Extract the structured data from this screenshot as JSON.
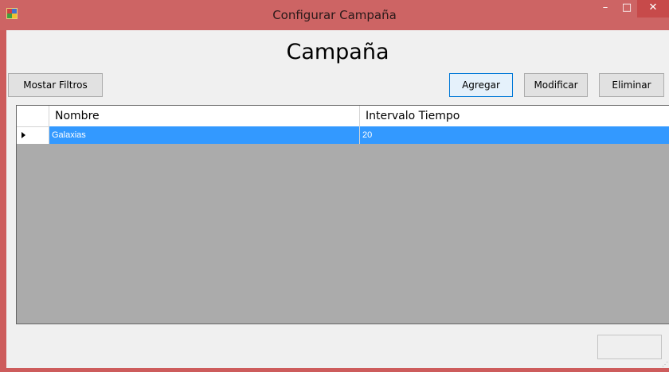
{
  "window": {
    "title": "Configurar Campaña",
    "minimize_glyph": "–",
    "maximize_glyph": "□",
    "close_glyph": "✕",
    "accent_color": "#cd6464"
  },
  "form": {
    "heading": "Campaña"
  },
  "toolbar": {
    "filters_label": "Mostar Filtros",
    "add_label": "Agregar",
    "modify_label": "Modificar",
    "delete_label": "Eliminar"
  },
  "grid": {
    "columns": [
      "Nombre",
      "Intervalo Tiempo"
    ],
    "rows": [
      {
        "nombre": "Galaxias",
        "intervalo": "20",
        "selected": true
      }
    ],
    "selection_color": "#3399ff"
  },
  "footer": {
    "action_label": ""
  }
}
